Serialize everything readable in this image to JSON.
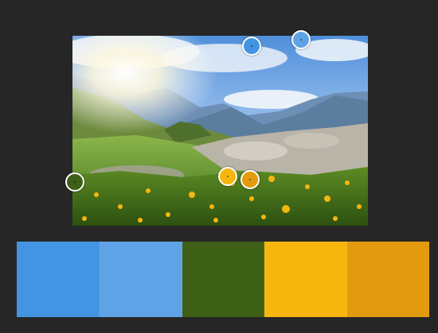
{
  "palette": {
    "swatches": [
      {
        "name": "blue",
        "color": "#4395E3"
      },
      {
        "name": "light-blue",
        "color": "#5FA3E6"
      },
      {
        "name": "dark-green",
        "color": "#3E6016"
      },
      {
        "name": "yellow",
        "color": "#F6B60E"
      },
      {
        "name": "orange",
        "color": "#E29B0E"
      }
    ]
  },
  "pickers": [
    {
      "name": "picker-blue",
      "color": "#4395E3"
    },
    {
      "name": "picker-light-blue",
      "color": "#5FA3E6"
    },
    {
      "name": "picker-dark-green",
      "color": "#3E6016"
    },
    {
      "name": "picker-yellow",
      "color": "#F6B60E"
    },
    {
      "name": "picker-orange",
      "color": "#E29B0E"
    }
  ],
  "photo": {
    "subject": "mountain-meadow-landscape-photo"
  }
}
